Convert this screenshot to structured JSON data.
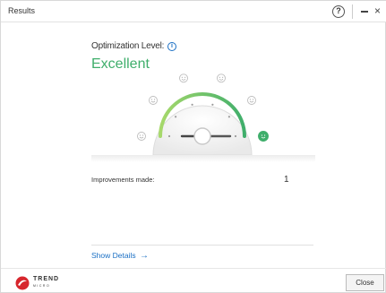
{
  "window": {
    "title": "Results",
    "help_glyph": "?",
    "close_glyph": "×"
  },
  "optimization": {
    "label": "Optimization Level:",
    "info_glyph": "i",
    "value": "Excellent",
    "level_index": 5,
    "level_count": 6,
    "accent_color": "#3fae6b"
  },
  "improvements": {
    "label": "Improvements made:",
    "value": "1"
  },
  "details_link": {
    "label": "Show Details",
    "arrow": "→"
  },
  "footer": {
    "logo_text": "TREND",
    "logo_subtext": "MICRO",
    "close_label": "Close"
  },
  "colors": {
    "link": "#1a6fc4",
    "brand_red": "#d7262d"
  },
  "icons": [
    "help-icon",
    "minimize-icon",
    "close-icon",
    "info-icon",
    "smiley-icon",
    "arrow-right-icon",
    "trend-micro-logo"
  ]
}
